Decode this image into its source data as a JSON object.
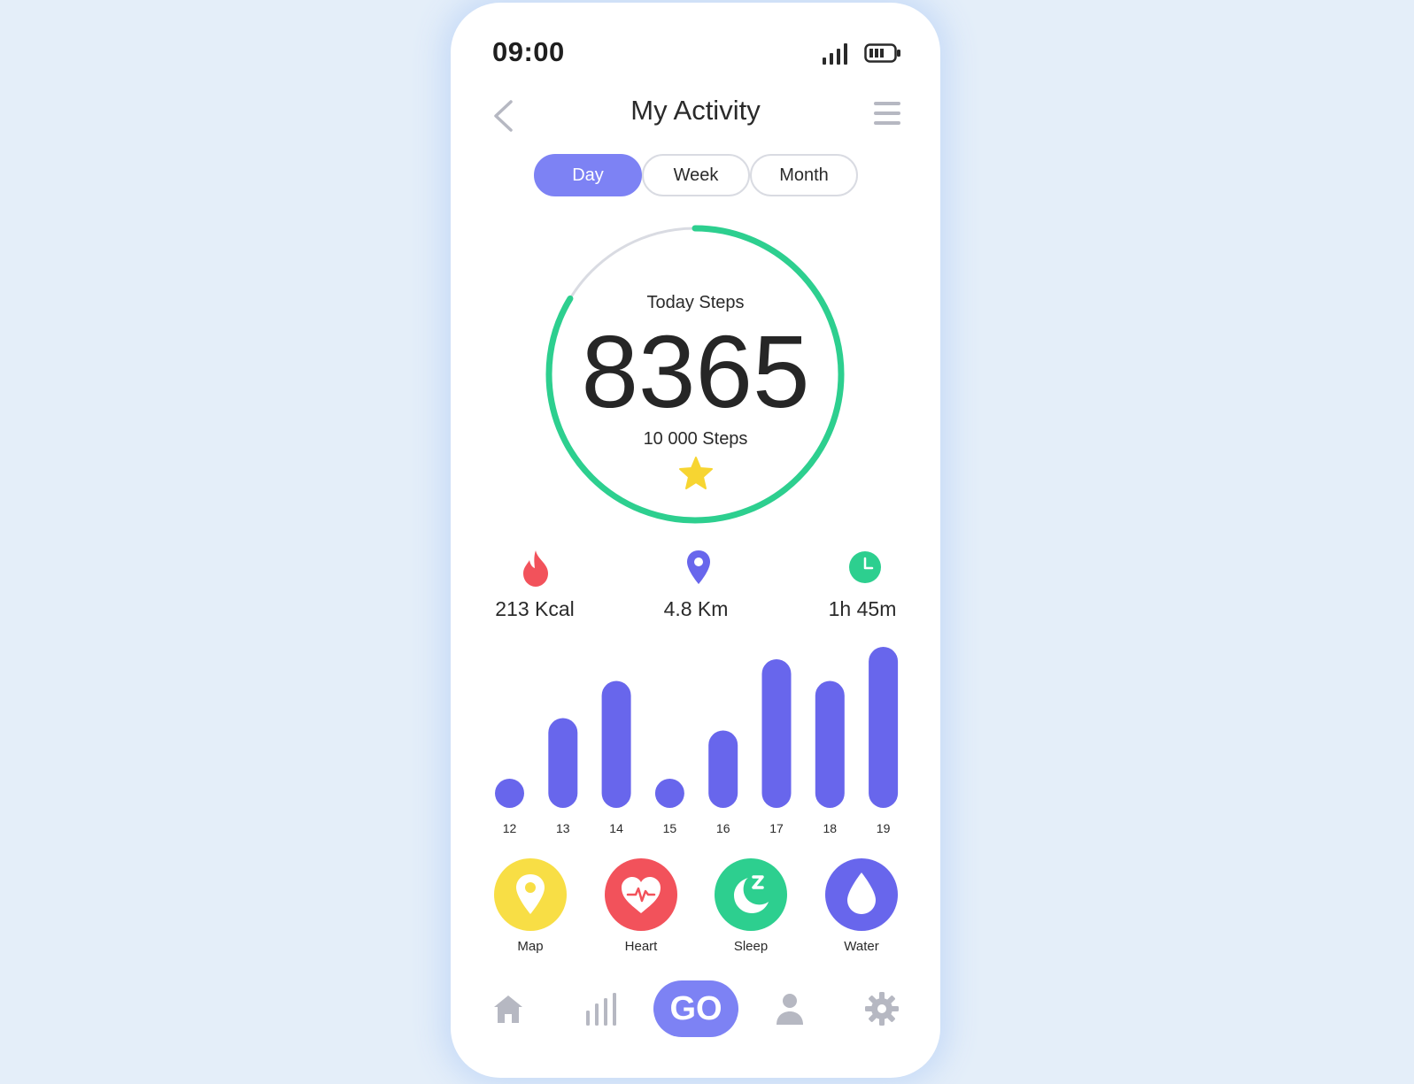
{
  "status_bar": {
    "time": "09:00",
    "signal_icon": "signal-bars-icon",
    "battery_icon": "battery-icon"
  },
  "header": {
    "back_icon": "chevron-left-icon",
    "title": "My Activity",
    "menu_icon": "hamburger-menu-icon"
  },
  "tabs": [
    {
      "label": "Day",
      "active": true
    },
    {
      "label": "Week",
      "active": false
    },
    {
      "label": "Month",
      "active": false
    }
  ],
  "steps": {
    "title": "Today Steps",
    "value": "8365",
    "goal_label": "10 000 Steps",
    "progress": 0.8365,
    "ring_color": "#2dcf8f",
    "track_color": "#d9dbe2",
    "star_color": "#f7d531"
  },
  "stats": [
    {
      "icon": "flame-icon",
      "value": "213 Kcal",
      "color": "#f2525b"
    },
    {
      "icon": "location-pin-icon",
      "value": "4.8 Km",
      "color": "#6866ec"
    },
    {
      "icon": "clock-icon",
      "value": "1h 45m",
      "color": "#2dcf8f"
    }
  ],
  "chart_data": {
    "type": "bar",
    "categories": [
      "12",
      "13",
      "14",
      "15",
      "16",
      "17",
      "18",
      "19"
    ],
    "values": [
      1,
      29,
      41,
      3,
      25,
      48,
      41,
      52
    ],
    "title": "",
    "xlabel": "",
    "ylabel": "",
    "ylim": [
      0,
      52
    ],
    "grid": false,
    "bar_color": "#6866ec"
  },
  "actions": [
    {
      "icon": "map-pin-icon",
      "label": "Map",
      "color": "#f8de45"
    },
    {
      "icon": "heart-icon",
      "label": "Heart",
      "color": "#f2525b"
    },
    {
      "icon": "moon-icon",
      "label": "Sleep",
      "color": "#2dcf8f"
    },
    {
      "icon": "water-drop-icon",
      "label": "Water",
      "color": "#6866ec"
    }
  ],
  "bottom_nav": {
    "items": [
      "home-icon",
      "stats-icon",
      "profile-icon",
      "settings-icon"
    ],
    "go_label": "GO",
    "accent": "#7d82f4"
  }
}
